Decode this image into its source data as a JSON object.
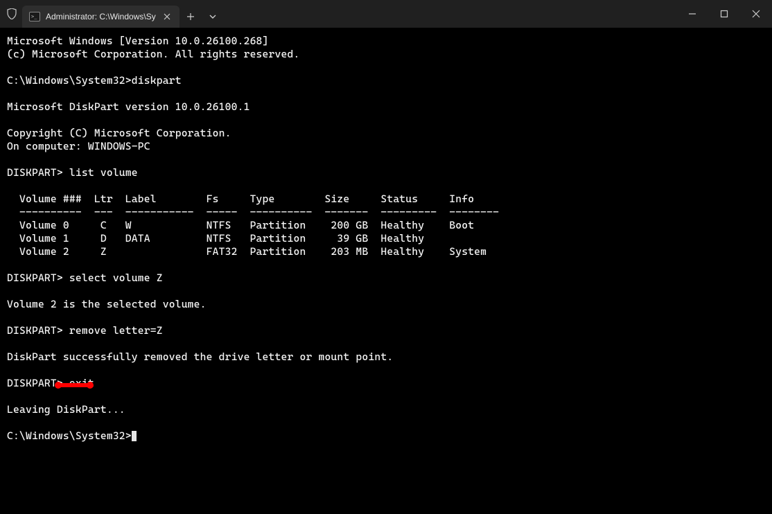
{
  "window": {
    "tab_title": "Administrator: C:\\Windows\\Sy",
    "new_tab_icon": "+",
    "dropdown_icon": "⌄"
  },
  "term": {
    "l1": "Microsoft Windows [Version 10.0.26100.268]",
    "l2": "(c) Microsoft Corporation. All rights reserved.",
    "l3": "",
    "l4": "C:\\Windows\\System32>diskpart",
    "l5": "",
    "l6": "Microsoft DiskPart version 10.0.26100.1",
    "l7": "",
    "l8": "Copyright (C) Microsoft Corporation.",
    "l9": "On computer: WINDOWS-PC",
    "l10": "",
    "l11": "DISKPART> list volume",
    "l12": "",
    "l13": "  Volume ###  Ltr  Label        Fs     Type        Size     Status     Info",
    "l14": "  ----------  ---  -----------  -----  ----------  -------  ---------  --------",
    "l15": "  Volume 0     C   W            NTFS   Partition    200 GB  Healthy    Boot",
    "l16": "  Volume 1     D   DATA         NTFS   Partition     39 GB  Healthy",
    "l17": "  Volume 2     Z                FAT32  Partition    203 MB  Healthy    System",
    "l18": "",
    "l19": "DISKPART> select volume Z",
    "l20": "",
    "l21": "Volume 2 is the selected volume.",
    "l22": "",
    "l23": "DISKPART> remove letter=Z",
    "l24": "",
    "l25": "DiskPart successfully removed the drive letter or mount point.",
    "l26": "",
    "l27": "DISKPART> exit",
    "l28": "",
    "l29": "Leaving DiskPart...",
    "l30": "",
    "l31": "C:\\Windows\\System32>"
  }
}
